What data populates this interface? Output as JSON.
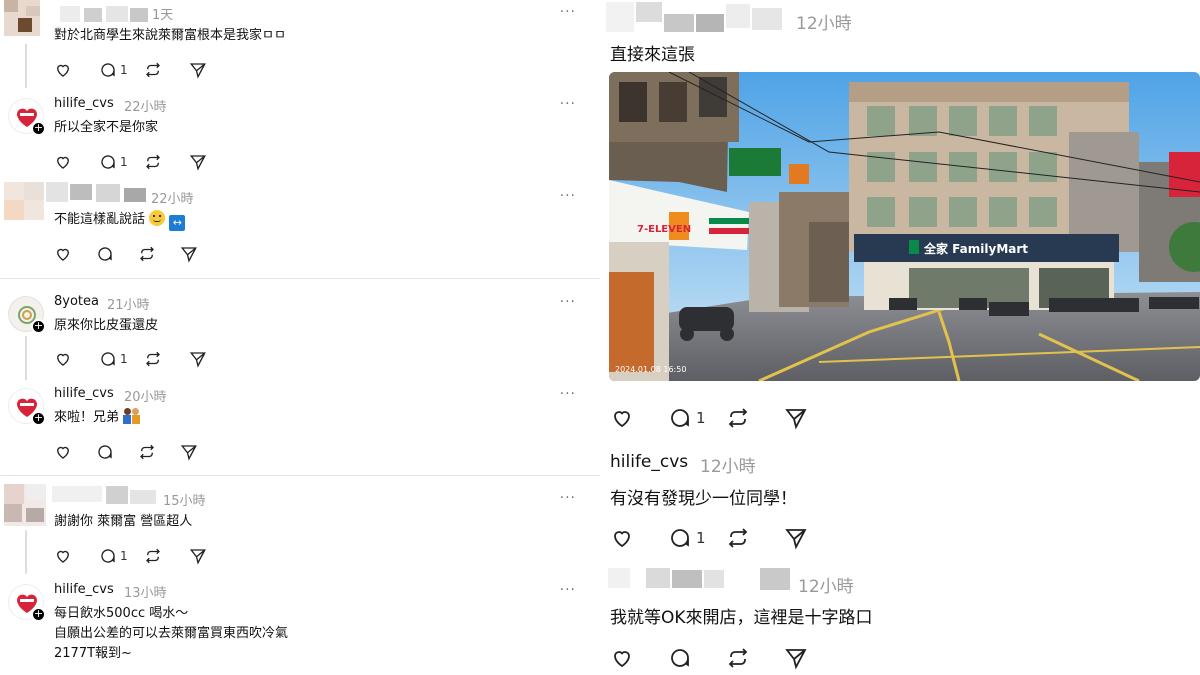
{
  "left": {
    "posts": [
      {
        "username": "",
        "time": "1天",
        "text": "對於北商學生來說萊爾富根本是我家ㅁㅁ",
        "reply_count": "1"
      },
      {
        "username": "hilife_cvs",
        "time": "22小時",
        "text": "所以全家不是你家",
        "reply_count": "1"
      },
      {
        "username": "",
        "time": "22小時",
        "text": "不能這樣亂說話",
        "reply_count": ""
      },
      {
        "username": "8yotea",
        "time": "21小時",
        "text": "原來你比皮蛋還皮",
        "reply_count": "1"
      },
      {
        "username": "hilife_cvs",
        "time": "20小時",
        "text": "來啦！兄弟",
        "reply_count": ""
      },
      {
        "username": "",
        "time": "15小時",
        "text": "謝謝你 萊爾富 營區超人",
        "reply_count": "1"
      },
      {
        "username": "hilife_cvs",
        "time": "13小時",
        "text_lines": [
          "每日飲水500cc 喝水～",
          "自願出公差的可以去萊爾富買東西吹冷氣",
          "2177T報到~"
        ],
        "reply_count": ""
      }
    ],
    "more_label": "···",
    "plus_label": "+"
  },
  "right": {
    "post1": {
      "username": "",
      "time": "12小時",
      "text": "直接來這張",
      "reply_count": "1"
    },
    "photo": {
      "store_left_sign": "7-ELEVEN",
      "store_right_sign": "全家 FamilyMart",
      "timestamp": "2024.01.08 16:50"
    },
    "post2": {
      "username": "hilife_cvs",
      "time": "12小時",
      "text": "有沒有發現少一位同學！",
      "reply_count": "1"
    },
    "post3": {
      "username": "",
      "time": "12小時",
      "text": "我就等OK來開店，這裡是十字路口",
      "reply_count": ""
    }
  },
  "colors": {
    "accent_red": "#d8243a",
    "muted": "#999999",
    "familymart_green": "#0a8a4a"
  }
}
